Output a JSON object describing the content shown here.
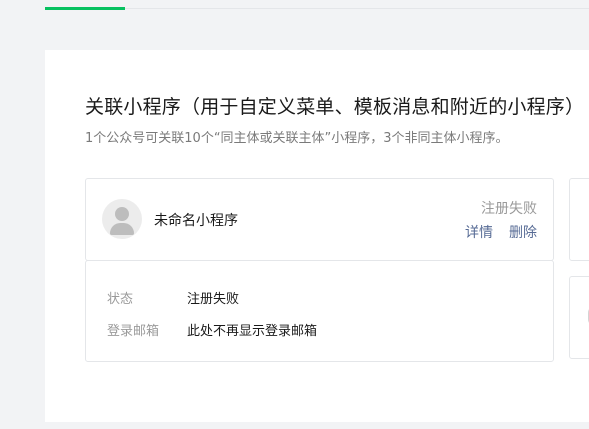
{
  "section": {
    "title": "关联小程序（用于自定义菜单、模板消息和附近的小程序）",
    "subtitle": "1个公众号可关联10个“同主体或关联主体”小程序，3个非同主体小程序。"
  },
  "app_card": {
    "name": "未命名小程序",
    "status": "注册失败",
    "detail_label": "详情",
    "delete_label": "删除",
    "rows": [
      {
        "label": "状态",
        "value": "注册失败"
      },
      {
        "label": "登录邮箱",
        "value": "此处不再显示登录邮箱"
      }
    ]
  },
  "colors": {
    "accent": "#07c160",
    "link": "#576b95",
    "muted": "#9a9a9a"
  }
}
